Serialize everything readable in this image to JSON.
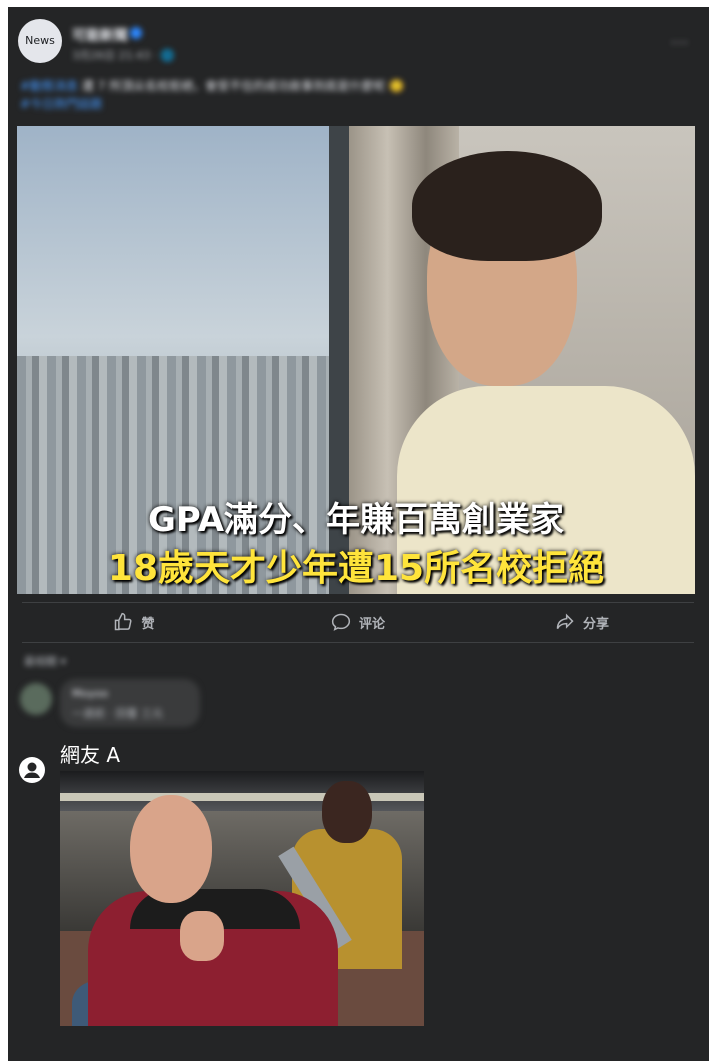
{
  "post": {
    "avatar_label": "News",
    "page_name": "可能新聞",
    "meta": "3月26日 21:43 · 🌐",
    "more_label": "···",
    "caption_link": "#動態消息",
    "caption_text": " 遭 7 所頂尖名校拒絕，會受不住的成功故事到底是什麼呢 🙂",
    "caption_hashtag": "#今日熱門話題"
  },
  "image": {
    "line1": "GPA滿分、年賺百萬創業家",
    "line2": "18歲天才少年遭15所名校拒絕"
  },
  "actions": [
    {
      "label": "赞",
      "icon": "thumb-up-icon"
    },
    {
      "label": "评论",
      "icon": "comment-icon"
    },
    {
      "label": "分享",
      "icon": "share-icon"
    }
  ],
  "comments": {
    "sort_label": "最相關 ▾",
    "first": {
      "name": "Moyoo",
      "text": "一週前 · 回覆 三元"
    },
    "user_name": "網友 A"
  },
  "colors": {
    "frame_bg": "#242526",
    "accent": "#2d88ff",
    "caption_yellow": "#ffe43b"
  }
}
